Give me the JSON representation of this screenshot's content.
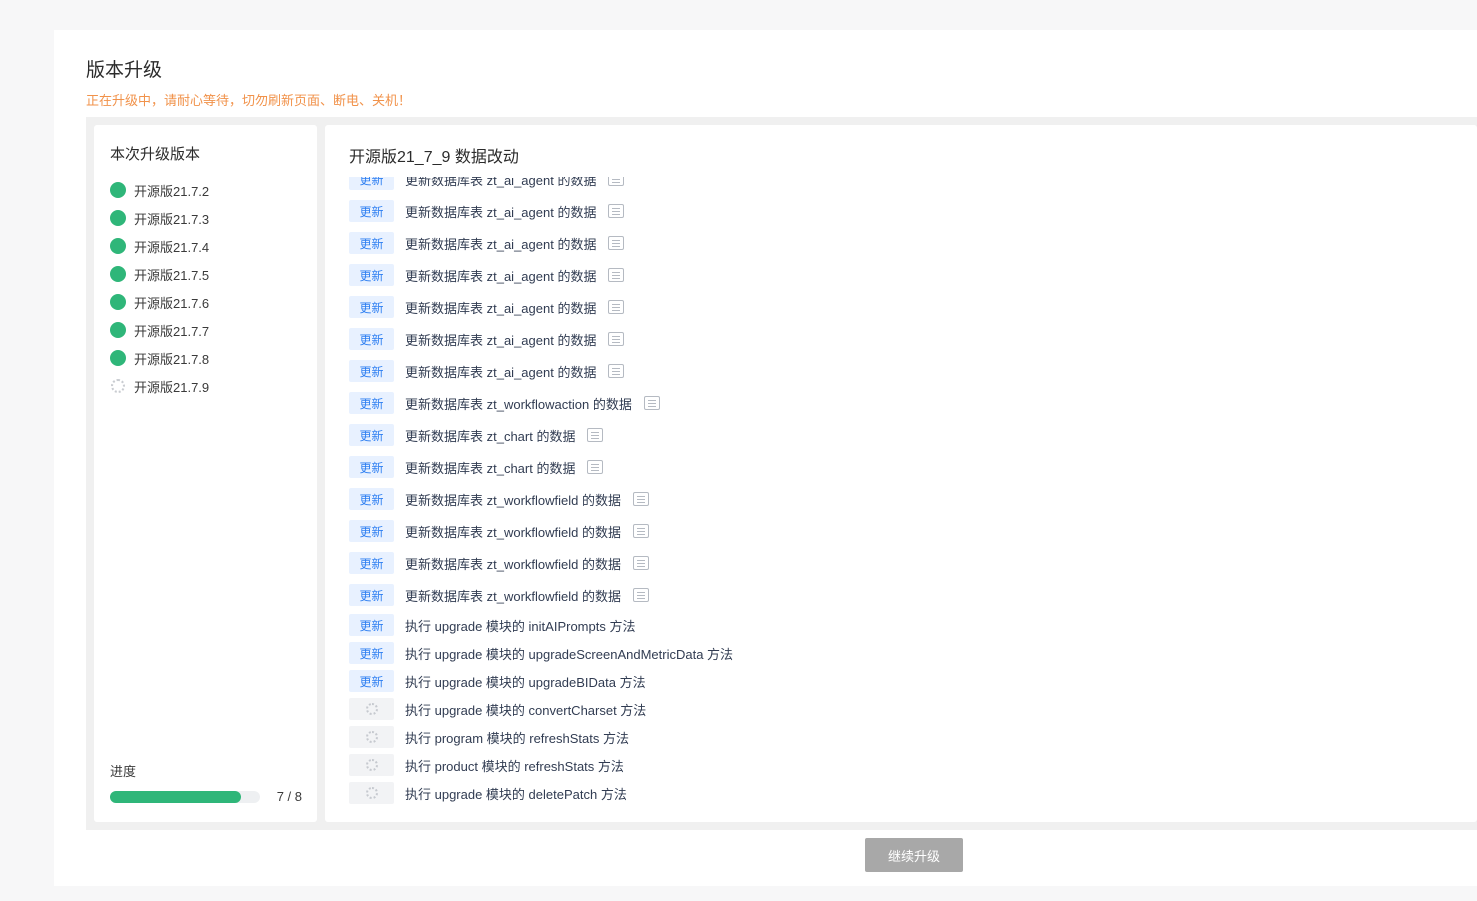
{
  "page": {
    "title": "版本升级",
    "warning": "正在升级中，请耐心等待，切勿刷新页面、断电、关机！"
  },
  "left": {
    "title": "本次升级版本",
    "versions": [
      {
        "label": "开源版21.7.2",
        "status": "done"
      },
      {
        "label": "开源版21.7.3",
        "status": "done"
      },
      {
        "label": "开源版21.7.4",
        "status": "done"
      },
      {
        "label": "开源版21.7.5",
        "status": "done"
      },
      {
        "label": "开源版21.7.6",
        "status": "done"
      },
      {
        "label": "开源版21.7.7",
        "status": "done"
      },
      {
        "label": "开源版21.7.8",
        "status": "done"
      },
      {
        "label": "开源版21.7.9",
        "status": "pending"
      }
    ],
    "progress_label": "进度",
    "progress_text": "7 / 8",
    "progress_fraction": 0.875
  },
  "right": {
    "title": "开源版21_7_9 数据改动",
    "update_tag": "更新",
    "items": [
      {
        "text": "更新数据库表 zt_ai_agent 的数据",
        "status": "update",
        "detail": true
      },
      {
        "text": "更新数据库表 zt_ai_agent 的数据",
        "status": "update",
        "detail": true
      },
      {
        "text": "更新数据库表 zt_ai_agent 的数据",
        "status": "update",
        "detail": true
      },
      {
        "text": "更新数据库表 zt_ai_agent 的数据",
        "status": "update",
        "detail": true
      },
      {
        "text": "更新数据库表 zt_ai_agent 的数据",
        "status": "update",
        "detail": true
      },
      {
        "text": "更新数据库表 zt_ai_agent 的数据",
        "status": "update",
        "detail": true
      },
      {
        "text": "更新数据库表 zt_ai_agent 的数据",
        "status": "update",
        "detail": true
      },
      {
        "text": "更新数据库表 zt_workflowaction 的数据",
        "status": "update",
        "detail": true
      },
      {
        "text": "更新数据库表 zt_chart 的数据",
        "status": "update",
        "detail": true
      },
      {
        "text": "更新数据库表 zt_chart 的数据",
        "status": "update",
        "detail": true
      },
      {
        "text": "更新数据库表 zt_workflowfield 的数据",
        "status": "update",
        "detail": true
      },
      {
        "text": "更新数据库表 zt_workflowfield 的数据",
        "status": "update",
        "detail": true
      },
      {
        "text": "更新数据库表 zt_workflowfield 的数据",
        "status": "update",
        "detail": true
      },
      {
        "text": "更新数据库表 zt_workflowfield 的数据",
        "status": "update",
        "detail": true
      },
      {
        "text": "执行 upgrade 模块的 initAIPrompts 方法",
        "status": "update",
        "detail": false
      },
      {
        "text": "执行 upgrade 模块的 upgradeScreenAndMetricData 方法",
        "status": "update",
        "detail": false
      },
      {
        "text": "执行 upgrade 模块的 upgradeBIData 方法",
        "status": "update",
        "detail": false
      },
      {
        "text": "执行 upgrade 模块的 convertCharset 方法",
        "status": "pending",
        "detail": false
      },
      {
        "text": "执行 program 模块的 refreshStats 方法",
        "status": "pending",
        "detail": false
      },
      {
        "text": "执行 product 模块的 refreshStats 方法",
        "status": "pending",
        "detail": false
      },
      {
        "text": "执行 upgrade 模块的 deletePatch 方法",
        "status": "pending",
        "detail": false
      }
    ]
  },
  "footer": {
    "continue_label": "继续升级"
  },
  "colors": {
    "accent_green": "#2fb679",
    "tag_blue": "#2e7ff2",
    "warning_orange": "#f1924a",
    "disabled_button": "#a8a8a8"
  }
}
